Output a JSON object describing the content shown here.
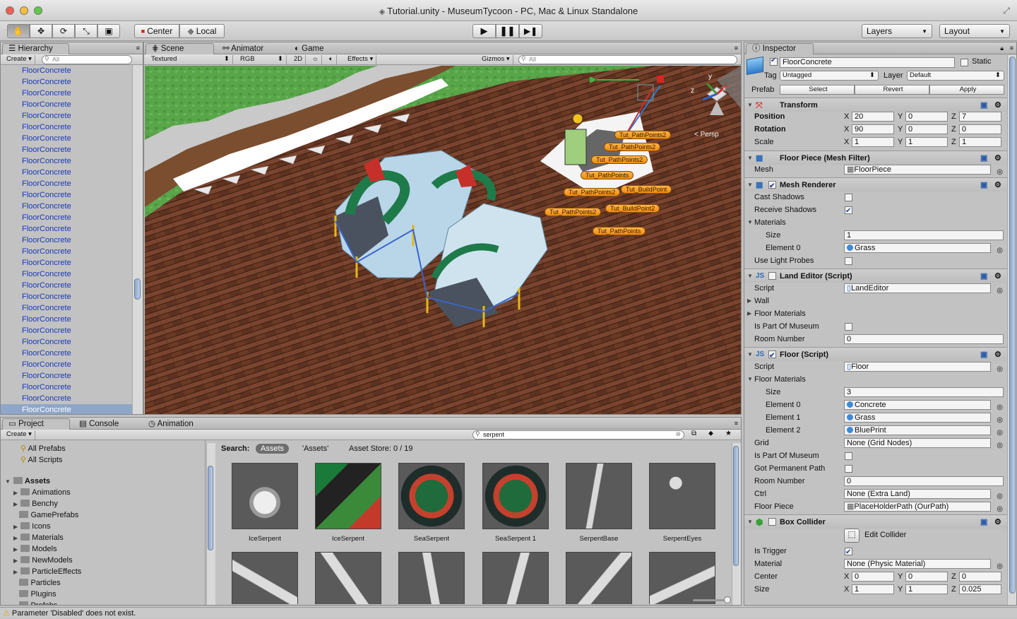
{
  "window": {
    "title": "Tutorial.unity - MuseumTycoon - PC, Mac & Linux Standalone"
  },
  "toolbar": {
    "center_label": "Center",
    "local_label": "Local",
    "layers_label": "Layers",
    "layout_label": "Layout"
  },
  "hierarchy": {
    "tab_label": "Hierarchy",
    "create_label": "Create",
    "search_placeholder": "All",
    "item_label": "FloorConcrete",
    "item_count": 31,
    "selected_index": 30
  },
  "scene": {
    "tabs": {
      "scene": "Scene",
      "animator": "Animator",
      "game": "Game"
    },
    "render_mode": "Textured",
    "color_mode": "RGB",
    "mode_2d": "2D",
    "effects": "Effects",
    "gizmos": "Gizmos",
    "search_placeholder": "All",
    "persp_label": "Persp",
    "labels": [
      "Tut_PathPoints2",
      "Tut_PathPoints2",
      "Tut_PathPoints2",
      "Tut_PathPoints",
      "Tut_PathPoints2",
      "Tut_BuildPoint",
      "Tut_PathPoints2",
      "Tut_BuildPoint2",
      "Tut_PathPoints"
    ]
  },
  "project": {
    "tabs": {
      "project": "Project",
      "console": "Console",
      "animation": "Animation"
    },
    "create_label": "Create",
    "search_value": "serpent",
    "favorites": [
      "All Prefabs",
      "All Scripts"
    ],
    "assets_root": "Assets",
    "folders": [
      "Animations",
      "Benchy",
      "GamePrefabs",
      "Icons",
      "Materials",
      "Models",
      "NewModels",
      "ParticleEffects",
      "Particles",
      "Plugins",
      "Prefabs"
    ],
    "search_label": "Search:",
    "search_scope_active": "Assets",
    "search_scope_2": "'Assets'",
    "asset_store_label": "Asset Store: 0 / 19",
    "assets": [
      "IceSerpent",
      "IceSerpent",
      "SeaSerpent",
      "SeaSerpent 1",
      "SerpentBase",
      "SerpentEyes"
    ]
  },
  "inspector": {
    "tab_label": "Inspector",
    "object_name": "FloorConcrete",
    "static_label": "Static",
    "tag_label": "Tag",
    "tag_value": "Untagged",
    "layer_label": "Layer",
    "layer_value": "Default",
    "prefab_label": "Prefab",
    "prefab_select": "Select",
    "prefab_revert": "Revert",
    "prefab_apply": "Apply",
    "transform": {
      "title": "Transform",
      "position_label": "Position",
      "rotation_label": "Rotation",
      "scale_label": "Scale",
      "position": {
        "x": "20",
        "y": "0",
        "z": "7"
      },
      "rotation": {
        "x": "90",
        "y": "0",
        "z": "0"
      },
      "scale": {
        "x": "1",
        "y": "1",
        "z": "1"
      }
    },
    "mesh_filter": {
      "title": "Floor Piece (Mesh Filter)",
      "mesh_label": "Mesh",
      "mesh_value": "FloorPiece"
    },
    "mesh_renderer": {
      "title": "Mesh Renderer",
      "cast_shadows": "Cast Shadows",
      "receive_shadows": "Receive Shadows",
      "materials": "Materials",
      "size_label": "Size",
      "size_value": "1",
      "element0_label": "Element 0",
      "element0_value": "Grass",
      "light_probes": "Use Light Probes"
    },
    "land_editor": {
      "title": "Land Editor (Script)",
      "script_label": "Script",
      "script_value": "LandEditor",
      "wall": "Wall",
      "floor_materials": "Floor Materials",
      "part_of_museum": "Is Part Of Museum",
      "room_number": "Room Number",
      "room_number_value": "0"
    },
    "floor_script": {
      "title": "Floor (Script)",
      "script_label": "Script",
      "script_value": "Floor",
      "floor_materials": "Floor Materials",
      "size_label": "Size",
      "size_value": "3",
      "element0_label": "Element 0",
      "element0_value": "Concrete",
      "element1_label": "Element 1",
      "element1_value": "Grass",
      "element2_label": "Element 2",
      "element2_value": "BluePrint",
      "grid_label": "Grid",
      "grid_value": "None (Grid Nodes)",
      "part_of_museum": "Is Part Of Museum",
      "permanent_path": "Got Permanent Path",
      "room_number": "Room Number",
      "room_number_value": "0",
      "ctrl_label": "Ctrl",
      "ctrl_value": "None (Extra Land)",
      "floor_piece_label": "Floor Piece",
      "floor_piece_value": "PlaceHolderPath (OurPath)"
    },
    "box_collider": {
      "title": "Box Collider",
      "edit_collider": "Edit Collider",
      "is_trigger": "Is Trigger",
      "material_label": "Material",
      "material_value": "None (Physic Material)",
      "center_label": "Center",
      "center": {
        "x": "0",
        "y": "0",
        "z": "0"
      },
      "size_label": "Size",
      "size": {
        "x": "1",
        "y": "1",
        "z": "0.025"
      }
    }
  },
  "status": {
    "message": "Parameter 'Disabled' does not exist."
  },
  "colors": {
    "selection": "#8ea6c8",
    "link_blue": "#1838b8",
    "label_orange": "#f39a20"
  }
}
